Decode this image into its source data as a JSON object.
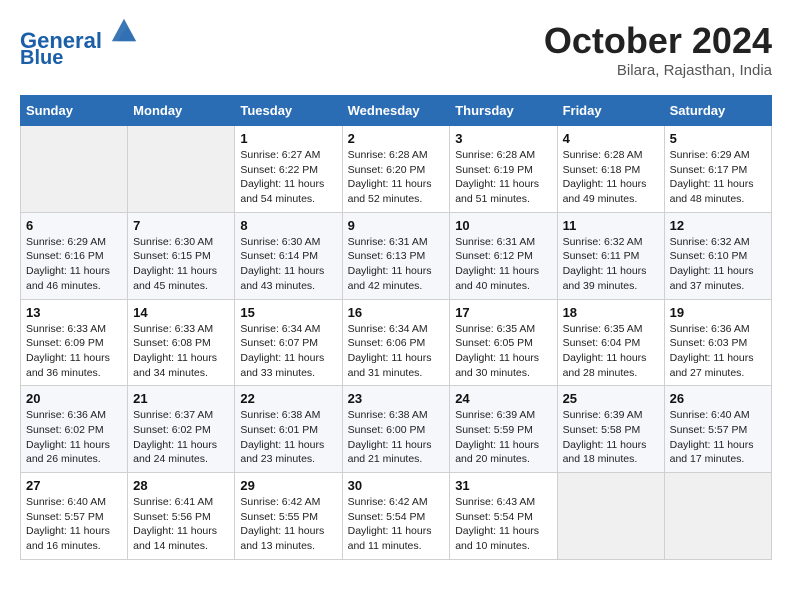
{
  "logo": {
    "line1": "General",
    "line2": "Blue"
  },
  "title": "October 2024",
  "subtitle": "Bilara, Rajasthan, India",
  "days_header": [
    "Sunday",
    "Monday",
    "Tuesday",
    "Wednesday",
    "Thursday",
    "Friday",
    "Saturday"
  ],
  "weeks": [
    [
      {
        "day": "",
        "info": ""
      },
      {
        "day": "",
        "info": ""
      },
      {
        "day": "1",
        "info": "Sunrise: 6:27 AM\nSunset: 6:22 PM\nDaylight: 11 hours and 54 minutes."
      },
      {
        "day": "2",
        "info": "Sunrise: 6:28 AM\nSunset: 6:20 PM\nDaylight: 11 hours and 52 minutes."
      },
      {
        "day": "3",
        "info": "Sunrise: 6:28 AM\nSunset: 6:19 PM\nDaylight: 11 hours and 51 minutes."
      },
      {
        "day": "4",
        "info": "Sunrise: 6:28 AM\nSunset: 6:18 PM\nDaylight: 11 hours and 49 minutes."
      },
      {
        "day": "5",
        "info": "Sunrise: 6:29 AM\nSunset: 6:17 PM\nDaylight: 11 hours and 48 minutes."
      }
    ],
    [
      {
        "day": "6",
        "info": "Sunrise: 6:29 AM\nSunset: 6:16 PM\nDaylight: 11 hours and 46 minutes."
      },
      {
        "day": "7",
        "info": "Sunrise: 6:30 AM\nSunset: 6:15 PM\nDaylight: 11 hours and 45 minutes."
      },
      {
        "day": "8",
        "info": "Sunrise: 6:30 AM\nSunset: 6:14 PM\nDaylight: 11 hours and 43 minutes."
      },
      {
        "day": "9",
        "info": "Sunrise: 6:31 AM\nSunset: 6:13 PM\nDaylight: 11 hours and 42 minutes."
      },
      {
        "day": "10",
        "info": "Sunrise: 6:31 AM\nSunset: 6:12 PM\nDaylight: 11 hours and 40 minutes."
      },
      {
        "day": "11",
        "info": "Sunrise: 6:32 AM\nSunset: 6:11 PM\nDaylight: 11 hours and 39 minutes."
      },
      {
        "day": "12",
        "info": "Sunrise: 6:32 AM\nSunset: 6:10 PM\nDaylight: 11 hours and 37 minutes."
      }
    ],
    [
      {
        "day": "13",
        "info": "Sunrise: 6:33 AM\nSunset: 6:09 PM\nDaylight: 11 hours and 36 minutes."
      },
      {
        "day": "14",
        "info": "Sunrise: 6:33 AM\nSunset: 6:08 PM\nDaylight: 11 hours and 34 minutes."
      },
      {
        "day": "15",
        "info": "Sunrise: 6:34 AM\nSunset: 6:07 PM\nDaylight: 11 hours and 33 minutes."
      },
      {
        "day": "16",
        "info": "Sunrise: 6:34 AM\nSunset: 6:06 PM\nDaylight: 11 hours and 31 minutes."
      },
      {
        "day": "17",
        "info": "Sunrise: 6:35 AM\nSunset: 6:05 PM\nDaylight: 11 hours and 30 minutes."
      },
      {
        "day": "18",
        "info": "Sunrise: 6:35 AM\nSunset: 6:04 PM\nDaylight: 11 hours and 28 minutes."
      },
      {
        "day": "19",
        "info": "Sunrise: 6:36 AM\nSunset: 6:03 PM\nDaylight: 11 hours and 27 minutes."
      }
    ],
    [
      {
        "day": "20",
        "info": "Sunrise: 6:36 AM\nSunset: 6:02 PM\nDaylight: 11 hours and 26 minutes."
      },
      {
        "day": "21",
        "info": "Sunrise: 6:37 AM\nSunset: 6:02 PM\nDaylight: 11 hours and 24 minutes."
      },
      {
        "day": "22",
        "info": "Sunrise: 6:38 AM\nSunset: 6:01 PM\nDaylight: 11 hours and 23 minutes."
      },
      {
        "day": "23",
        "info": "Sunrise: 6:38 AM\nSunset: 6:00 PM\nDaylight: 11 hours and 21 minutes."
      },
      {
        "day": "24",
        "info": "Sunrise: 6:39 AM\nSunset: 5:59 PM\nDaylight: 11 hours and 20 minutes."
      },
      {
        "day": "25",
        "info": "Sunrise: 6:39 AM\nSunset: 5:58 PM\nDaylight: 11 hours and 18 minutes."
      },
      {
        "day": "26",
        "info": "Sunrise: 6:40 AM\nSunset: 5:57 PM\nDaylight: 11 hours and 17 minutes."
      }
    ],
    [
      {
        "day": "27",
        "info": "Sunrise: 6:40 AM\nSunset: 5:57 PM\nDaylight: 11 hours and 16 minutes."
      },
      {
        "day": "28",
        "info": "Sunrise: 6:41 AM\nSunset: 5:56 PM\nDaylight: 11 hours and 14 minutes."
      },
      {
        "day": "29",
        "info": "Sunrise: 6:42 AM\nSunset: 5:55 PM\nDaylight: 11 hours and 13 minutes."
      },
      {
        "day": "30",
        "info": "Sunrise: 6:42 AM\nSunset: 5:54 PM\nDaylight: 11 hours and 11 minutes."
      },
      {
        "day": "31",
        "info": "Sunrise: 6:43 AM\nSunset: 5:54 PM\nDaylight: 11 hours and 10 minutes."
      },
      {
        "day": "",
        "info": ""
      },
      {
        "day": "",
        "info": ""
      }
    ]
  ]
}
